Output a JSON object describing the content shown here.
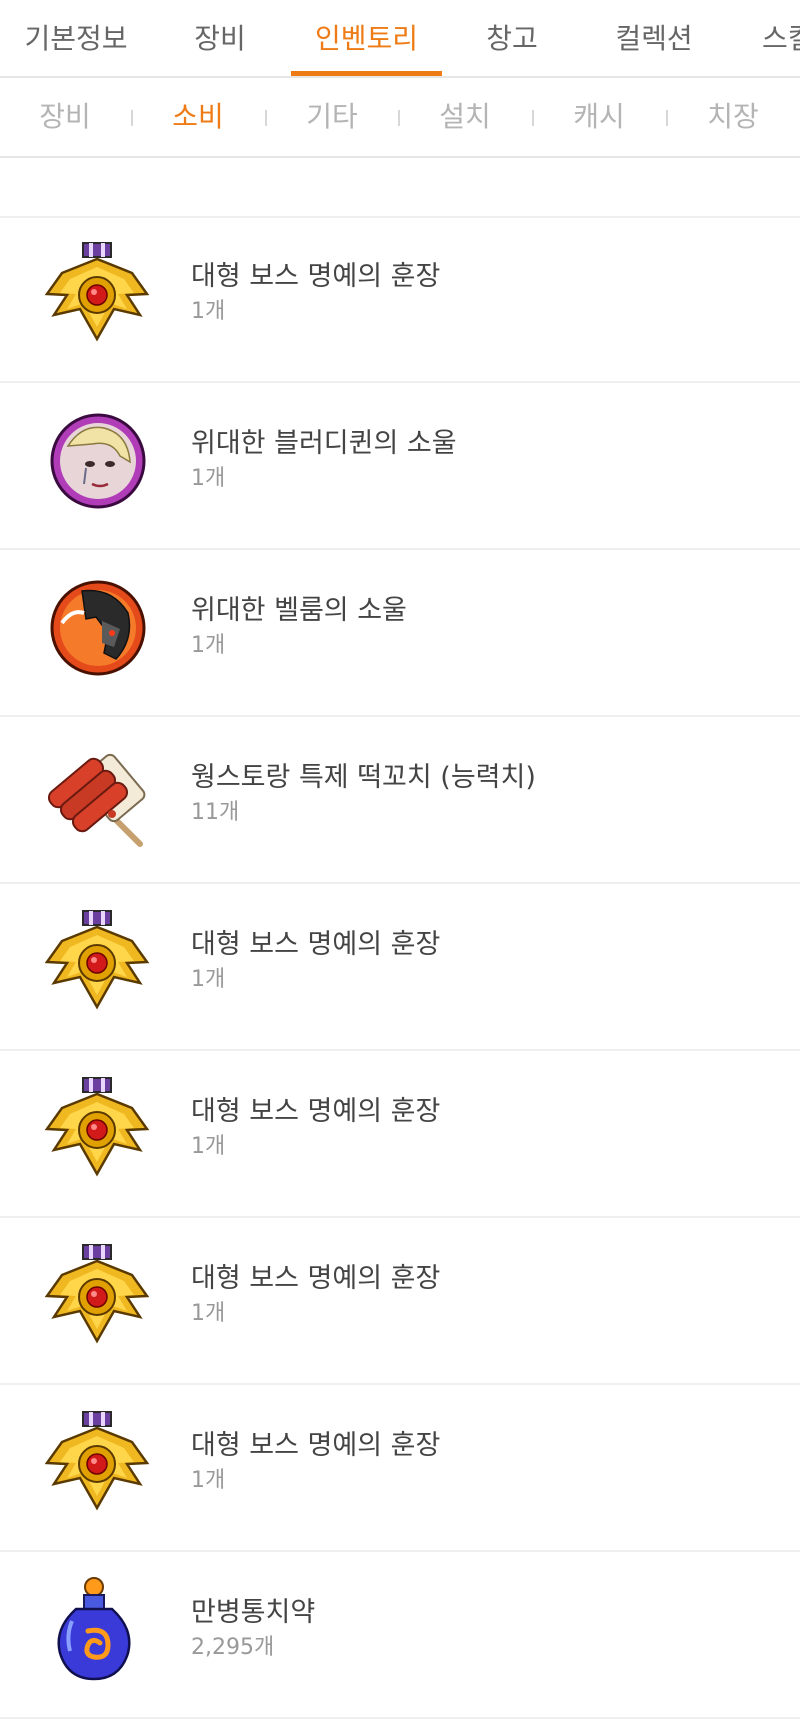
{
  "top_tabs": [
    {
      "label": "기본정보",
      "active": false
    },
    {
      "label": "장비",
      "active": false
    },
    {
      "label": "인벤토리",
      "active": true
    },
    {
      "label": "창고",
      "active": false
    },
    {
      "label": "컬렉션",
      "active": false
    },
    {
      "label": "스킬",
      "active": false
    }
  ],
  "sub_tabs": [
    {
      "label": "장비",
      "active": false
    },
    {
      "label": "소비",
      "active": true
    },
    {
      "label": "기타",
      "active": false
    },
    {
      "label": "설치",
      "active": false
    },
    {
      "label": "캐시",
      "active": false
    },
    {
      "label": "치장",
      "active": false
    }
  ],
  "colors": {
    "accent": "#ee7b16",
    "inactive_tab": "#666666",
    "inactive_subtab": "#b4b4b4"
  },
  "items": [
    {
      "name": "대형 보스 명예의 훈장",
      "qty": "1개",
      "icon": "medal-icon"
    },
    {
      "name": "위대한 블러디퀸의 소울",
      "qty": "1개",
      "icon": "bloody-queen-soul-icon"
    },
    {
      "name": "위대한 벨룸의 소울",
      "qty": "1개",
      "icon": "vellum-soul-icon"
    },
    {
      "name": "웡스토랑 특제 떡꼬치 (능력치)",
      "qty": "11개",
      "icon": "rice-cake-skewer-icon"
    },
    {
      "name": "대형 보스 명예의 훈장",
      "qty": "1개",
      "icon": "medal-icon"
    },
    {
      "name": "대형 보스 명예의 훈장",
      "qty": "1개",
      "icon": "medal-icon"
    },
    {
      "name": "대형 보스 명예의 훈장",
      "qty": "1개",
      "icon": "medal-icon"
    },
    {
      "name": "대형 보스 명예의 훈장",
      "qty": "1개",
      "icon": "medal-icon"
    },
    {
      "name": "만병통치약",
      "qty": "2,295개",
      "icon": "potion-icon"
    }
  ]
}
